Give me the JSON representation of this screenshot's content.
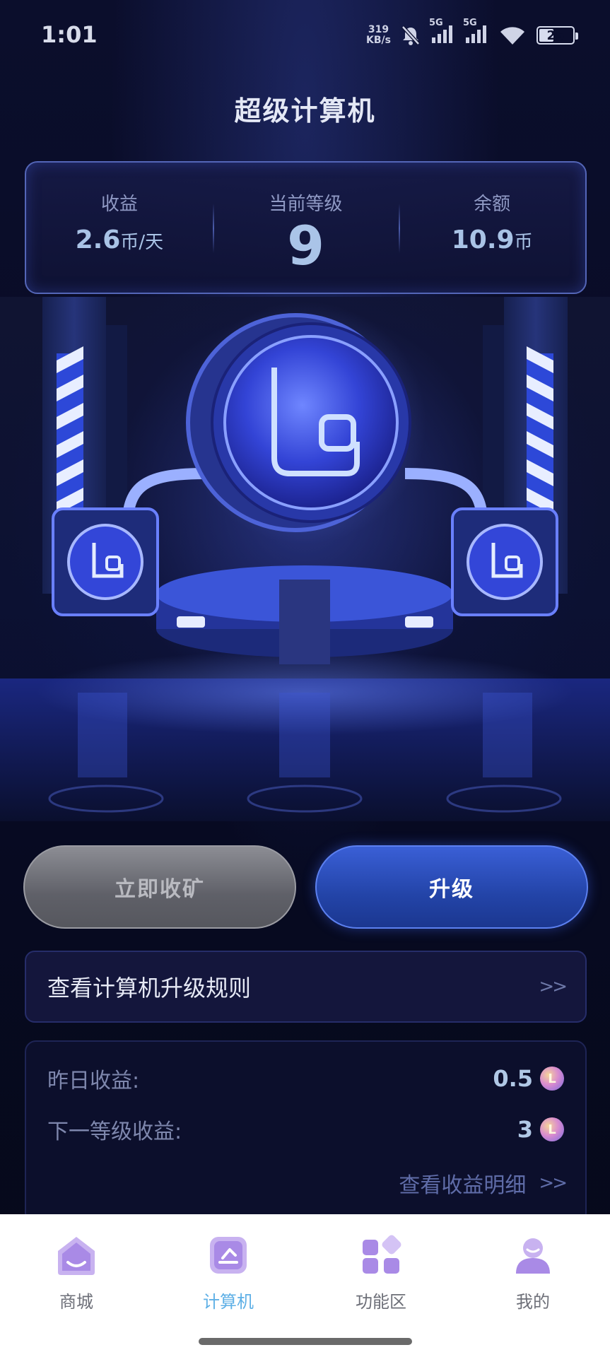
{
  "status_bar": {
    "time": "1:01",
    "speed_value": "319",
    "speed_unit": "KB/s",
    "network_1": "5G",
    "network_2": "5G",
    "battery": "25"
  },
  "title": "超级计算机",
  "stats": {
    "income_label": "收益",
    "income_value": "2.6",
    "income_unit": "币/天",
    "level_label": "当前等级",
    "level_value": "9",
    "balance_label": "余额",
    "balance_value": "10.9",
    "balance_unit": "币"
  },
  "hero": {
    "coin_symbol": "L"
  },
  "buttons": {
    "collect_label": "立即收矿",
    "upgrade_label": "升级"
  },
  "rules": {
    "label": "查看计算机升级规则",
    "arrow": ">>"
  },
  "earnings": {
    "yesterday_label": "昨日收益:",
    "yesterday_value": "0.5",
    "next_level_label": "下一等级收益:",
    "next_level_value": "3",
    "detail_label": "查看收益明细",
    "detail_arrow": ">>",
    "coin_symbol": "L"
  },
  "tabs": [
    {
      "label": "商城",
      "icon": "shop-icon",
      "active": false
    },
    {
      "label": "计算机",
      "icon": "computer-icon",
      "active": true
    },
    {
      "label": "功能区",
      "icon": "grid-icon",
      "active": false
    },
    {
      "label": "我的",
      "icon": "user-icon",
      "active": false
    }
  ],
  "colors": {
    "background": "#070a1f",
    "card_border": "#5466b8",
    "accent_blue": "#3a5fd6",
    "value_blue": "#a9c3e6",
    "tab_active": "#5fb0e6",
    "tab_inactive": "#6d6f78",
    "tab_icon": "#b79be8"
  }
}
